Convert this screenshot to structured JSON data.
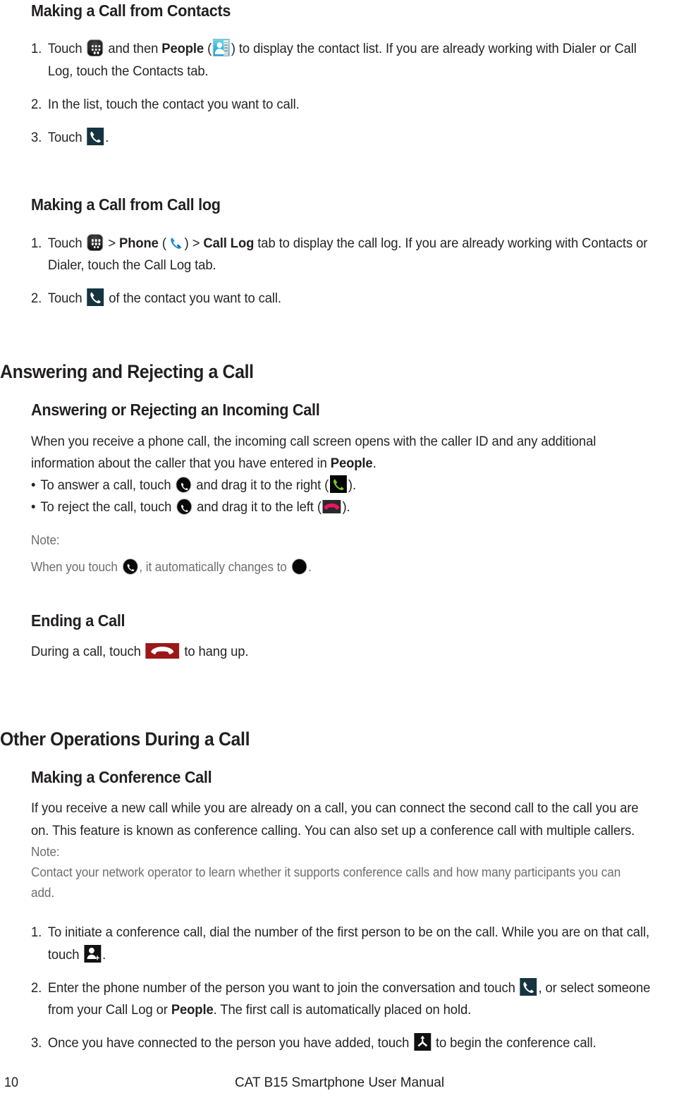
{
  "document": {
    "title": "CAT B15 Smartphone User Manual",
    "page_number": "10"
  },
  "sections": [
    {
      "id": "making-call-contacts",
      "heading": "Making a Call from Contacts",
      "level": 2,
      "items": [
        {
          "num": "1.",
          "parts": [
            {
              "t": "text",
              "v": "Touch "
            },
            {
              "t": "icon",
              "v": "app-drawer-icon"
            },
            {
              "t": "text",
              "v": " and then "
            },
            {
              "t": "bold",
              "v": "People"
            },
            {
              "t": "text",
              "v": " ("
            },
            {
              "t": "icon",
              "v": "people-app-icon"
            },
            {
              "t": "text",
              "v": ") to display the contact list. If you are already working with Dialer or Call Log, touch the Contacts tab."
            }
          ]
        },
        {
          "num": "2.",
          "parts": [
            {
              "t": "text",
              "v": "In the list, touch the contact you want to call."
            }
          ]
        },
        {
          "num": "3.",
          "parts": [
            {
              "t": "text",
              "v": "Touch "
            },
            {
              "t": "icon",
              "v": "call-dark-icon"
            },
            {
              "t": "text",
              "v": "."
            }
          ]
        }
      ]
    },
    {
      "id": "making-call-call-log",
      "heading": "Making a Call from Call log",
      "level": 2,
      "items": [
        {
          "num": "1.",
          "parts": [
            {
              "t": "text",
              "v": "Touch "
            },
            {
              "t": "icon",
              "v": "app-drawer-icon"
            },
            {
              "t": "text",
              "v": " > "
            },
            {
              "t": "bold",
              "v": "Phone"
            },
            {
              "t": "text",
              "v": " ("
            },
            {
              "t": "icon",
              "v": "phone-blue-icon"
            },
            {
              "t": "text",
              "v": ") > "
            },
            {
              "t": "bold",
              "v": "Call Log"
            },
            {
              "t": "text",
              "v": " tab to display the call log. If you are already working with Contacts or Dialer, touch the Call Log tab."
            }
          ]
        },
        {
          "num": "2.",
          "parts": [
            {
              "t": "text",
              "v": "Touch "
            },
            {
              "t": "icon",
              "v": "call-dark-icon"
            },
            {
              "t": "text",
              "v": " of the contact you want to call."
            }
          ]
        }
      ]
    }
  ],
  "answering": {
    "heading": "Answering and Rejecting a Call",
    "subheading": "Answering or Rejecting an Incoming Call",
    "paragraph": [
      {
        "t": "text",
        "v": "When you receive a phone call, the incoming call screen opens with the caller ID and any additional information about the caller that you have entered in "
      },
      {
        "t": "bold",
        "v": "People"
      },
      {
        "t": "text",
        "v": "."
      }
    ],
    "bullets": [
      {
        "parts": [
          {
            "t": "text",
            "v": "To answer a call, touch "
          },
          {
            "t": "icon",
            "v": "answer-circle-icon"
          },
          {
            "t": "text",
            "v": " and drag it to the right ("
          },
          {
            "t": "icon",
            "v": "answer-green-icon"
          },
          {
            "t": "text",
            "v": ")."
          }
        ]
      },
      {
        "parts": [
          {
            "t": "text",
            "v": "To reject the call, touch "
          },
          {
            "t": "icon",
            "v": "answer-circle-icon"
          },
          {
            "t": "text",
            "v": " and drag it to the left ("
          },
          {
            "t": "icon",
            "v": "reject-pink-icon"
          },
          {
            "t": "text",
            "v": ")."
          }
        ]
      }
    ],
    "note_label": "Note:",
    "note_parts": [
      {
        "t": "text",
        "v": "When you touch "
      },
      {
        "t": "icon",
        "v": "answer-circle-icon"
      },
      {
        "t": "text",
        "v": ", it automatically changes to "
      },
      {
        "t": "icon",
        "v": "black-circle-icon"
      },
      {
        "t": "text",
        "v": "."
      }
    ]
  },
  "ending": {
    "heading": "Ending a Call",
    "parts": [
      {
        "t": "text",
        "v": "During a call, touch "
      },
      {
        "t": "icon",
        "v": "hangup-red-icon"
      },
      {
        "t": "text",
        "v": " to hang up."
      }
    ]
  },
  "other_ops": {
    "heading": "Other Operations During a Call",
    "subheading": "Making a Conference Call",
    "paragraph": "If you receive a new call while you are already on a call, you can connect the second call to the call you are on. This feature is known as conference calling. You can also set up a conference call with multiple callers.",
    "note_label": "Note:",
    "note_text": "Contact your network operator to learn whether it supports conference calls and how many participants you can add.",
    "items": [
      {
        "num": "1.",
        "parts": [
          {
            "t": "text",
            "v": "To initiate a conference call, dial the number of the first person to be on the call. While you are on that call, touch "
          },
          {
            "t": "icon",
            "v": "add-person-icon"
          },
          {
            "t": "text",
            "v": "."
          }
        ]
      },
      {
        "num": "2.",
        "parts": [
          {
            "t": "text",
            "v": "Enter the phone number of the person you want to join the conversation and touch "
          },
          {
            "t": "icon",
            "v": "call-dark-icon"
          },
          {
            "t": "text",
            "v": ", or select someone from your Call Log or "
          },
          {
            "t": "bold",
            "v": "People"
          },
          {
            "t": "text",
            "v": ". The first call is automatically placed on hold."
          }
        ]
      },
      {
        "num": "3.",
        "parts": [
          {
            "t": "text",
            "v": "Once you have connected to the person you have added, touch "
          },
          {
            "t": "icon",
            "v": "merge-call-icon"
          },
          {
            "t": "text",
            "v": " to begin the conference call."
          }
        ]
      }
    ]
  },
  "colors": {
    "text": "#262425",
    "heading": "#231f20",
    "note": "#6d6e71",
    "people_icon": "#24b6e0",
    "call_dark": "#16343f",
    "answer_green": "#7ec624",
    "reject_pink": "#ee1465",
    "hangup_red": "#9c1717",
    "phone_blue": "#1a8fd6"
  }
}
